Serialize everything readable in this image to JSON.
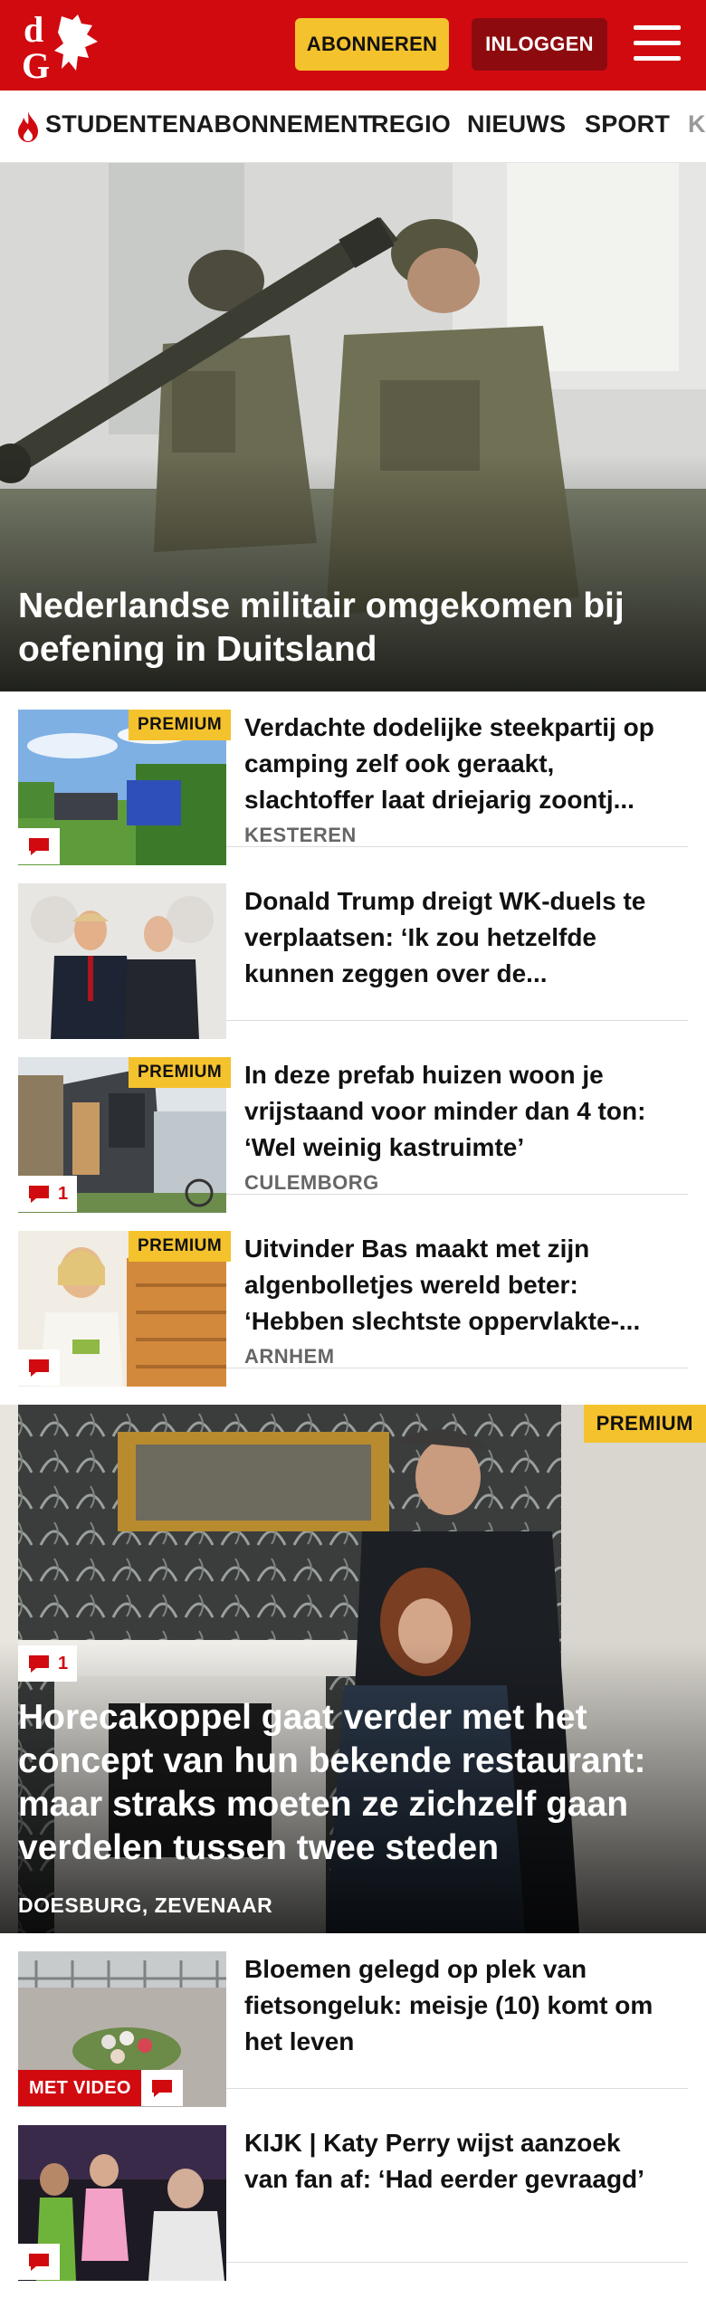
{
  "header": {
    "logo_alt": "dG",
    "subscribe_label": "ABONNEREN",
    "login_label": "INLOGGEN",
    "colors": {
      "brand_red": "#d10a10",
      "dark_red": "#8d0b0f",
      "premium_yellow": "#f4c22d"
    }
  },
  "nav": {
    "items": [
      "STUDENTENABONNEMENT",
      "REGIO",
      "NIEUWS",
      "SPORT",
      "K"
    ]
  },
  "hero": {
    "title": "Nederlandse militair omgekomen bij oefening in Duitsland"
  },
  "articles": [
    {
      "title": "Verdachte dodelijke steekpartij op camping zelf ook geraakt, slachtoffer laat driejarig zoontj...",
      "location": "KESTEREN",
      "premium": "PREMIUM",
      "comments": ""
    },
    {
      "title": "Donald Trump dreigt WK-duels te verplaatsen: ‘Ik zou hetzelfde kunnen zeggen over de...",
      "location": "",
      "premium": "",
      "comments": ""
    },
    {
      "title": "In deze prefab huizen woon je vrijstaand voor minder dan 4 ton: ‘Wel weinig kastruimte’",
      "location": "CULEMBORG",
      "premium": "PREMIUM",
      "comments": "1"
    },
    {
      "title": "Uitvinder Bas maakt met zijn algenbolletjes wereld beter: ‘Hebben slechtste oppervlakte-...",
      "location": "ARNHEM",
      "premium": "PREMIUM",
      "comments": ""
    }
  ],
  "feature": {
    "title": "Horecakoppel gaat verder met het concept van hun bekende restaurant: maar straks moeten ze zichzelf gaan verdelen tussen twee steden",
    "location": "DOESBURG, ZEVENAAR",
    "premium": "PREMIUM",
    "comments": "1"
  },
  "articles2": [
    {
      "title": "Bloemen gelegd op plek van fietsongeluk: meisje (10) komt om het leven",
      "video_label": "MET VIDEO"
    },
    {
      "title": "KIJK | Katy Perry wijst aanzoek van fan af: ‘Had eerder gevraagd’"
    }
  ]
}
